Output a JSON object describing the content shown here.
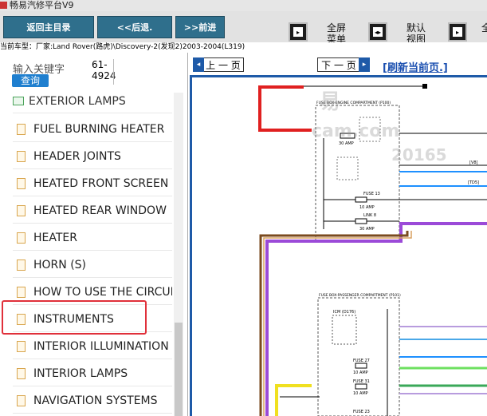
{
  "window": {
    "title": "畅易汽修平台V9"
  },
  "toolbar": {
    "home_label": "返回主目录",
    "back_label": "<<后退.",
    "forward_label": ">>前进",
    "fullscreen_label_1": "全屏",
    "fullscreen_label_2": "菜单",
    "default_view_label_1": "默认",
    "default_view_label_2": "视图"
  },
  "model": {
    "text": "当前车型：厂家:Land Rover(路虎)\\Discovery-2(发现2)2003-2004(L319)"
  },
  "search": {
    "label": "输入关键字",
    "button": "查询",
    "code_line1": "61-",
    "code_line2": "4924"
  },
  "tree": {
    "folder": "EXTERIOR LAMPS",
    "items": [
      "FUEL BURNING HEATER",
      "HEADER JOINTS",
      "HEATED FRONT SCREEN",
      "HEATED REAR WINDOW",
      "HEATER",
      "HORN (S)",
      "HOW TO USE THE CIRCUIT D",
      "INSTRUMENTS",
      "INTERIOR ILLUMINATION",
      "INTERIOR LAMPS",
      "NAVIGATION SYSTEMS"
    ]
  },
  "viewer": {
    "prev_label": "上 一 页",
    "next_label": "下 一 页",
    "refresh_label": "[刷新当前页.]",
    "diagram": {
      "box1_title": "FUSE BOX-ENGINE COMPARTMENT (P100)",
      "box2_title": "FUSE BOX-PASSENGER COMPARTMENT (P101)",
      "icm_label": "ICM (D176)",
      "fuse_a": "30 AMP",
      "fuse_13": "FUSE 13",
      "fuse_13_amp": "10 AMP",
      "link_8": "LINK 8",
      "link_8_amp": "30 AMP",
      "fuse_27": "FUSE 27",
      "fuse_27_amp": "10 AMP",
      "fuse_31": "FUSE 31",
      "fuse_31_amp": "10 AMP",
      "fuse_23": "FUSE 23",
      "v8_label": "[V8]",
      "td5_label": "[TD5]"
    },
    "watermark": {
      "w1": "易",
      "w2": "cam.com",
      "w3": "20165"
    }
  },
  "colors": {
    "accent": "#2f6f8c",
    "red": "#e0303a",
    "purple": "#9b4ad8",
    "brown": "#7a4a1e",
    "blue": "#1e5aa8"
  }
}
